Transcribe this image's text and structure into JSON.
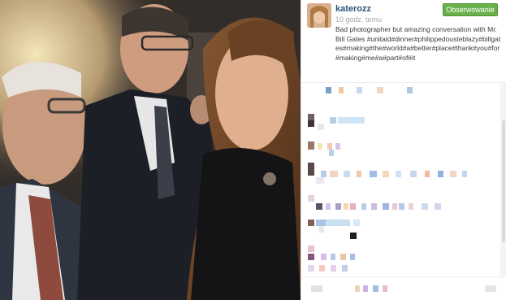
{
  "post": {
    "username": "katerozz",
    "timestamp": "10 godz. temu",
    "follow_label": "Obserwowanie",
    "caption": "Bad photographer but amazing conversation with Mr. Bill Gates #unitaid#dinner#philippedousteblazy#billgates#making#the#world#a#better#place#thank#you#for#making#me#a#part#of#it"
  },
  "photo": {
    "description_icon": "photo-image"
  },
  "colors": {
    "username": "#2b5478",
    "follow_button": "#6ab04b",
    "timestamp": "#a5a5a5"
  }
}
